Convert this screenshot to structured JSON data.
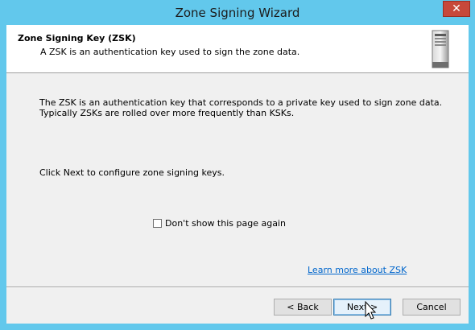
{
  "window": {
    "title": "Zone Signing Wizard",
    "close_glyph": "✕"
  },
  "header": {
    "title": "Zone Signing Key (ZSK)",
    "subtitle": "A ZSK is an authentication key used to sign the zone data.",
    "icon": "server-icon"
  },
  "body": {
    "paragraph_line1": "The ZSK is an authentication key that corresponds to a private key used to sign zone data.",
    "paragraph_line2": "Typically ZSKs are rolled over more frequently than KSKs.",
    "instruction": "Click Next to configure zone signing keys.",
    "checkbox_label": "Don't show this page again",
    "checkbox_checked": false,
    "learn_more": "Learn more about ZSK"
  },
  "footer": {
    "back_label": "< Back",
    "next_label": "Next >",
    "cancel_label": "Cancel"
  },
  "colors": {
    "frame": "#62c8ec",
    "close": "#c7483a",
    "link": "#0066cc"
  }
}
